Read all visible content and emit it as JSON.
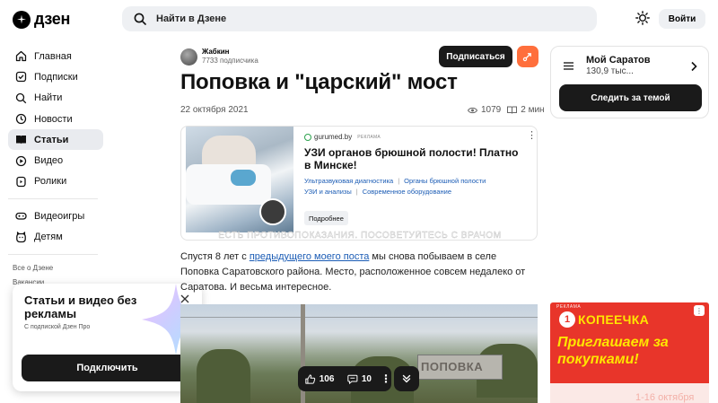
{
  "header": {
    "logo_text": "дзен",
    "search_placeholder": "Найти в Дзене",
    "login_label": "Войти"
  },
  "sidebar": {
    "items": [
      {
        "label": "Главная",
        "icon": "home-icon"
      },
      {
        "label": "Подписки",
        "icon": "subscriptions-icon"
      },
      {
        "label": "Найти",
        "icon": "search-icon"
      },
      {
        "label": "Новости",
        "icon": "news-icon"
      },
      {
        "label": "Статьи",
        "icon": "articles-icon",
        "active": true
      },
      {
        "label": "Видео",
        "icon": "video-icon"
      },
      {
        "label": "Ролики",
        "icon": "clips-icon"
      }
    ],
    "extra_items": [
      {
        "label": "Видеоигры",
        "icon": "gamepad-icon"
      },
      {
        "label": "Детям",
        "icon": "kids-icon"
      }
    ],
    "small_links": [
      "Все о Дзене",
      "Вакансии"
    ]
  },
  "promo": {
    "title": "Статьи и видео без рекламы",
    "subtitle": "С подпиской Дзен Про",
    "button": "Подключить"
  },
  "article": {
    "author_name": "Жабкин",
    "author_subs": "7733 подписчика",
    "subscribe_label": "Подписаться",
    "title": "Поповка и \"царский\" мост",
    "date": "22 октября 2021",
    "views": "1079",
    "read_time": "2 мин",
    "text_before_link": "Спустя 8 лет с ",
    "link_text": "предыдущего моего поста",
    "text_after_link": " мы снова побываем в селе Поповка Саратовского района. Место, расположенное совсем недалеко от Саратова. И весьма интересное.",
    "photo_sign": "ПОПОВКА"
  },
  "inline_ad": {
    "domain": "gurumed.by",
    "ad_label": "РЕКЛАМА",
    "headline": "УЗИ органов брюшной полости! Платно в Минске!",
    "links_row1": [
      "Ультразвуковая диагностика",
      "Органы брюшной полости"
    ],
    "links_row2": [
      "УЗИ и анализы",
      "Современное оборудование"
    ],
    "more_label": "Подробнее",
    "disclaimer": "ЕСТЬ ПРОТИВОПОКАЗАНИЯ. ПОСОВЕТУЙТЕСЬ С ВРАЧОМ"
  },
  "reactions": {
    "likes": "106",
    "comments": "10"
  },
  "topic_card": {
    "title": "Мой Саратов",
    "subscribers": "130,9 тыс...",
    "button": "Следить за темой"
  },
  "side_ad": {
    "label": "РЕКЛАМА",
    "brand_number": "1",
    "brand_name": "КОПЕЕЧКА",
    "headline": "Приглашаем за покупками!",
    "date": "1-16 октября"
  },
  "colors": {
    "accent_orange": "#ff6f3c",
    "dark_button": "#1a1a1a",
    "link_blue": "#1b5cb5",
    "ad_red": "#e8352a",
    "ad_yellow": "#ffe600"
  }
}
